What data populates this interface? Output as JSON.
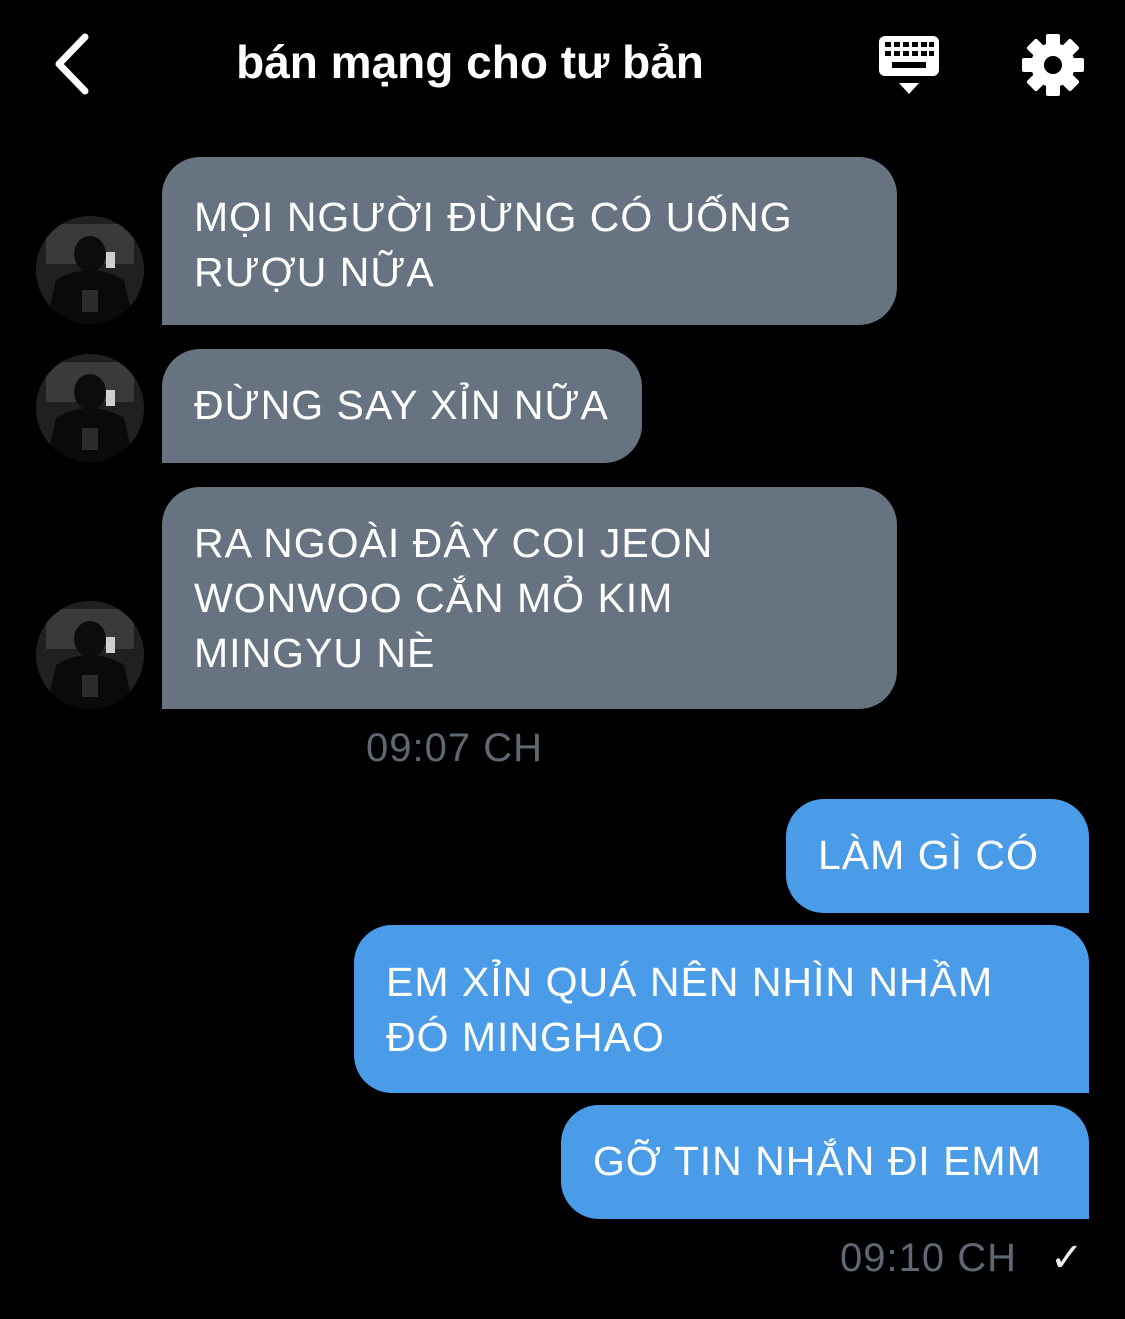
{
  "header": {
    "title": "bán mạng cho tư bản",
    "back_icon": "chevron-left-icon",
    "keyboard_icon": "keyboard-icon",
    "settings_icon": "gear-icon"
  },
  "colors": {
    "background": "#000000",
    "incoming_bubble": "#677380",
    "outgoing_bubble": "#4a9ce8",
    "timestamp": "#5f6772"
  },
  "messages": {
    "incoming": [
      {
        "lines": [
          "MỌI NGƯỜI ĐỪNG CÓ UỐNG",
          "RƯỢU NỮA"
        ]
      },
      {
        "lines": [
          "ĐỪNG SAY XỈN NỮA"
        ]
      },
      {
        "lines": [
          "RA NGOÀI ĐÂY COI JEON",
          "WONWOO CẮN MỎ KIM",
          "MINGYU NÈ"
        ]
      }
    ],
    "incoming_time": "09:07 CH",
    "outgoing": [
      {
        "lines": [
          "LÀM GÌ CÓ"
        ]
      },
      {
        "lines": [
          "EM XỈN QUÁ NÊN NHÌN NHẦM",
          "ĐÓ MINGHAO"
        ]
      },
      {
        "lines": [
          "GỠ TIN NHẮN ĐI EMM"
        ]
      }
    ],
    "outgoing_time": "09:10 CH",
    "read_mark": "✓"
  }
}
